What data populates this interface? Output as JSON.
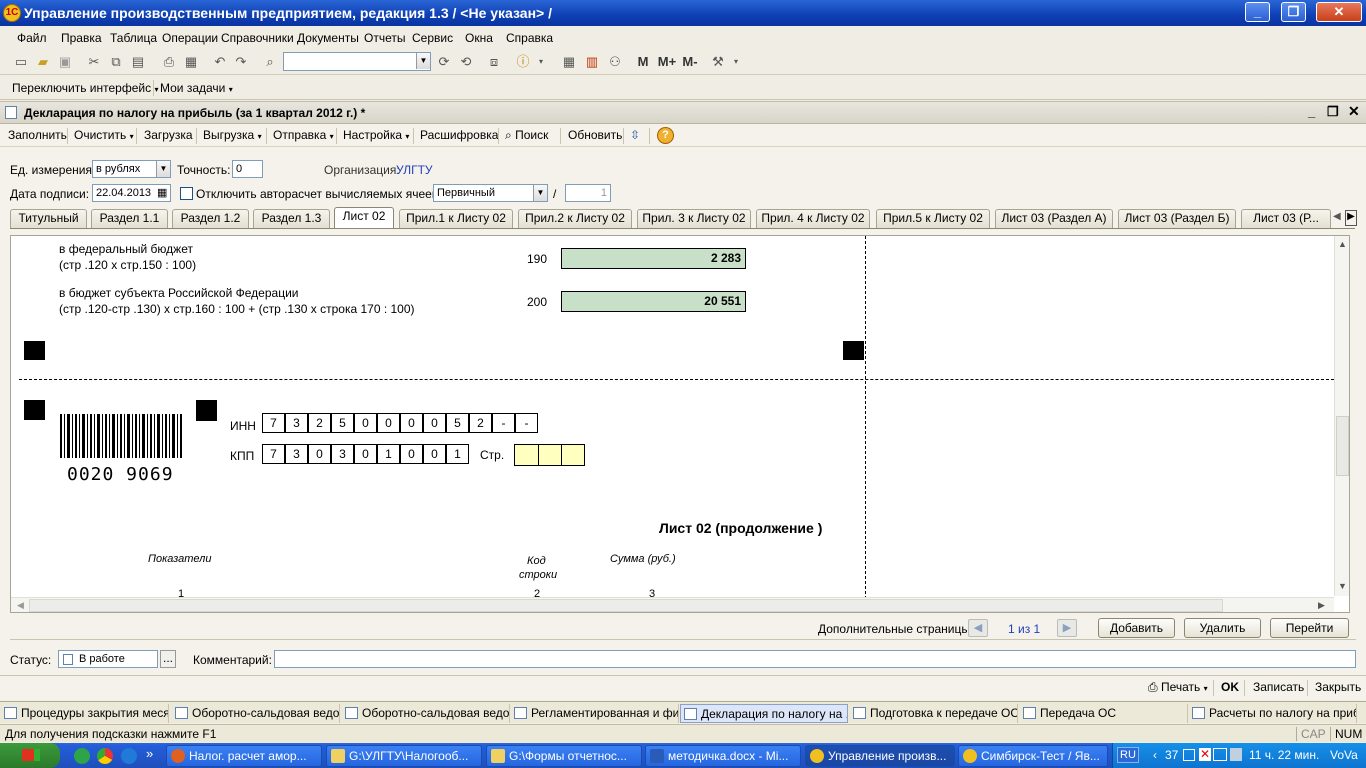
{
  "window": {
    "title": "Управление производственным предприятием, редакция 1.3 / <Не указан> /"
  },
  "menu": [
    "Файл",
    "Правка",
    "Таблица",
    "Операции",
    "Справочники",
    "Документы",
    "Отчеты",
    "Сервис",
    "Окна",
    "Справка"
  ],
  "toolbar2": {
    "switch_interface": "Переключить интерфейс",
    "my_tasks": "Мои задачи"
  },
  "toolbar_extra": {
    "m": "M",
    "mplus": "M+",
    "mminus": "M-"
  },
  "document": {
    "title": "Декларация по налогу на прибыль (за 1 квартал 2012 г.) *",
    "toolbar": [
      "Заполнить",
      "Очистить",
      "Загрузка",
      "Выгрузка",
      "Отправка",
      "Настройка",
      "Расшифровка",
      "Поиск",
      "Обновить"
    ],
    "unit_label": "Ед. измерения:",
    "unit_value": "в рублях",
    "precision_label": "Точность:",
    "precision_value": "0",
    "org_label": "Организация:",
    "org_value": "УЛГТУ",
    "sign_date_label": "Дата подписи:",
    "sign_date_value": "22.04.2013",
    "autocalc_label": "Отключить авторасчет вычисляемых ячеек",
    "kind_value": "Первичный",
    "slash": "/",
    "kind_number": "1",
    "tabs": [
      "Титульный",
      "Раздел 1.1",
      "Раздел 1.2",
      "Раздел 1.3",
      "Лист 02",
      "Прил.1 к Листу 02",
      "Прил.2 к Листу 02",
      "Прил. 3 к Листу 02",
      "Прил. 4 к Листу 02",
      "Прил.5 к Листу 02",
      "Лист 03 (Раздел А)",
      "Лист 03 (Раздел Б)",
      "Лист 03 (Р..."
    ],
    "active_tab": "Лист 02"
  },
  "sheet": {
    "row190_line1": "в федеральный бюджет",
    "row190_line2": "(стр .120 х стр.150 : 100)",
    "row190_code": "190",
    "row190_value": "2 283",
    "row200_line1": "в бюджет субъекта Российской Федерации",
    "row200_line2": "(стр .120-стр .130) х стр.160 : 100 + (стр .130 х строка 170 : 100)",
    "row200_code": "200",
    "row200_value": "20 551",
    "barcode_text": "0020 9069",
    "inn_label": "ИНН",
    "inn_cells": [
      "7",
      "3",
      "2",
      "5",
      "0",
      "0",
      "0",
      "0",
      "5",
      "2",
      "-",
      "-"
    ],
    "kpp_label": "КПП",
    "kpp_cells": [
      "7",
      "3",
      "0",
      "3",
      "0",
      "1",
      "0",
      "0",
      "1"
    ],
    "page_label": "Стр.",
    "sheet_title": "Лист 02 (продолжение )",
    "col1_header": "Показатели",
    "col2_header_line1": "Код",
    "col2_header_line2": "строки",
    "col3_header": "Сумма (руб.)",
    "col1_num": "1",
    "col2_num": "2",
    "col3_num": "3"
  },
  "pages": {
    "label": "Дополнительные страницы:",
    "counter": "1 из 1",
    "add": "Добавить",
    "delete": "Удалить",
    "goto": "Перейти"
  },
  "status": {
    "label": "Статус:",
    "value": "В работе",
    "more": "...",
    "comment_label": "Комментарий:"
  },
  "bottom_actions": {
    "print": "Печать",
    "ok": "OK",
    "save": "Записать",
    "close": "Закрыть"
  },
  "windows": [
    "Процедуры закрытия меся...",
    "Оборотно-сальдовая ведо...",
    "Оборотно-сальдовая ведо...",
    "Регламентированная и фи...",
    "Декларация по налогу на ...",
    "Подготовка к передаче ОС",
    "Передача ОС",
    "Расчеты по налогу на приб..."
  ],
  "active_window": "Декларация по налогу на ...",
  "statusbar": {
    "hint": "Для получения подсказки нажмите F1",
    "cap": "CAP",
    "num": "NUM"
  },
  "taskbar": {
    "items": [
      "Налог. расчет амор...",
      "G:\\УЛГТУ\\Налогооб...",
      "G:\\Формы отчетнос...",
      "методичка.docx - Mi...",
      "Управление произв...",
      "Симбирск-Тест / Яв..."
    ],
    "lang": "RU",
    "num": "37",
    "clock": "11 ч. 22 мин.",
    "user": "VoVa"
  },
  "colors": {
    "title_blue": "#0e3fb4",
    "cell_green": "#c8dfc8",
    "cell_yellow": "#ffffc0",
    "link_blue": "#2040c0"
  }
}
